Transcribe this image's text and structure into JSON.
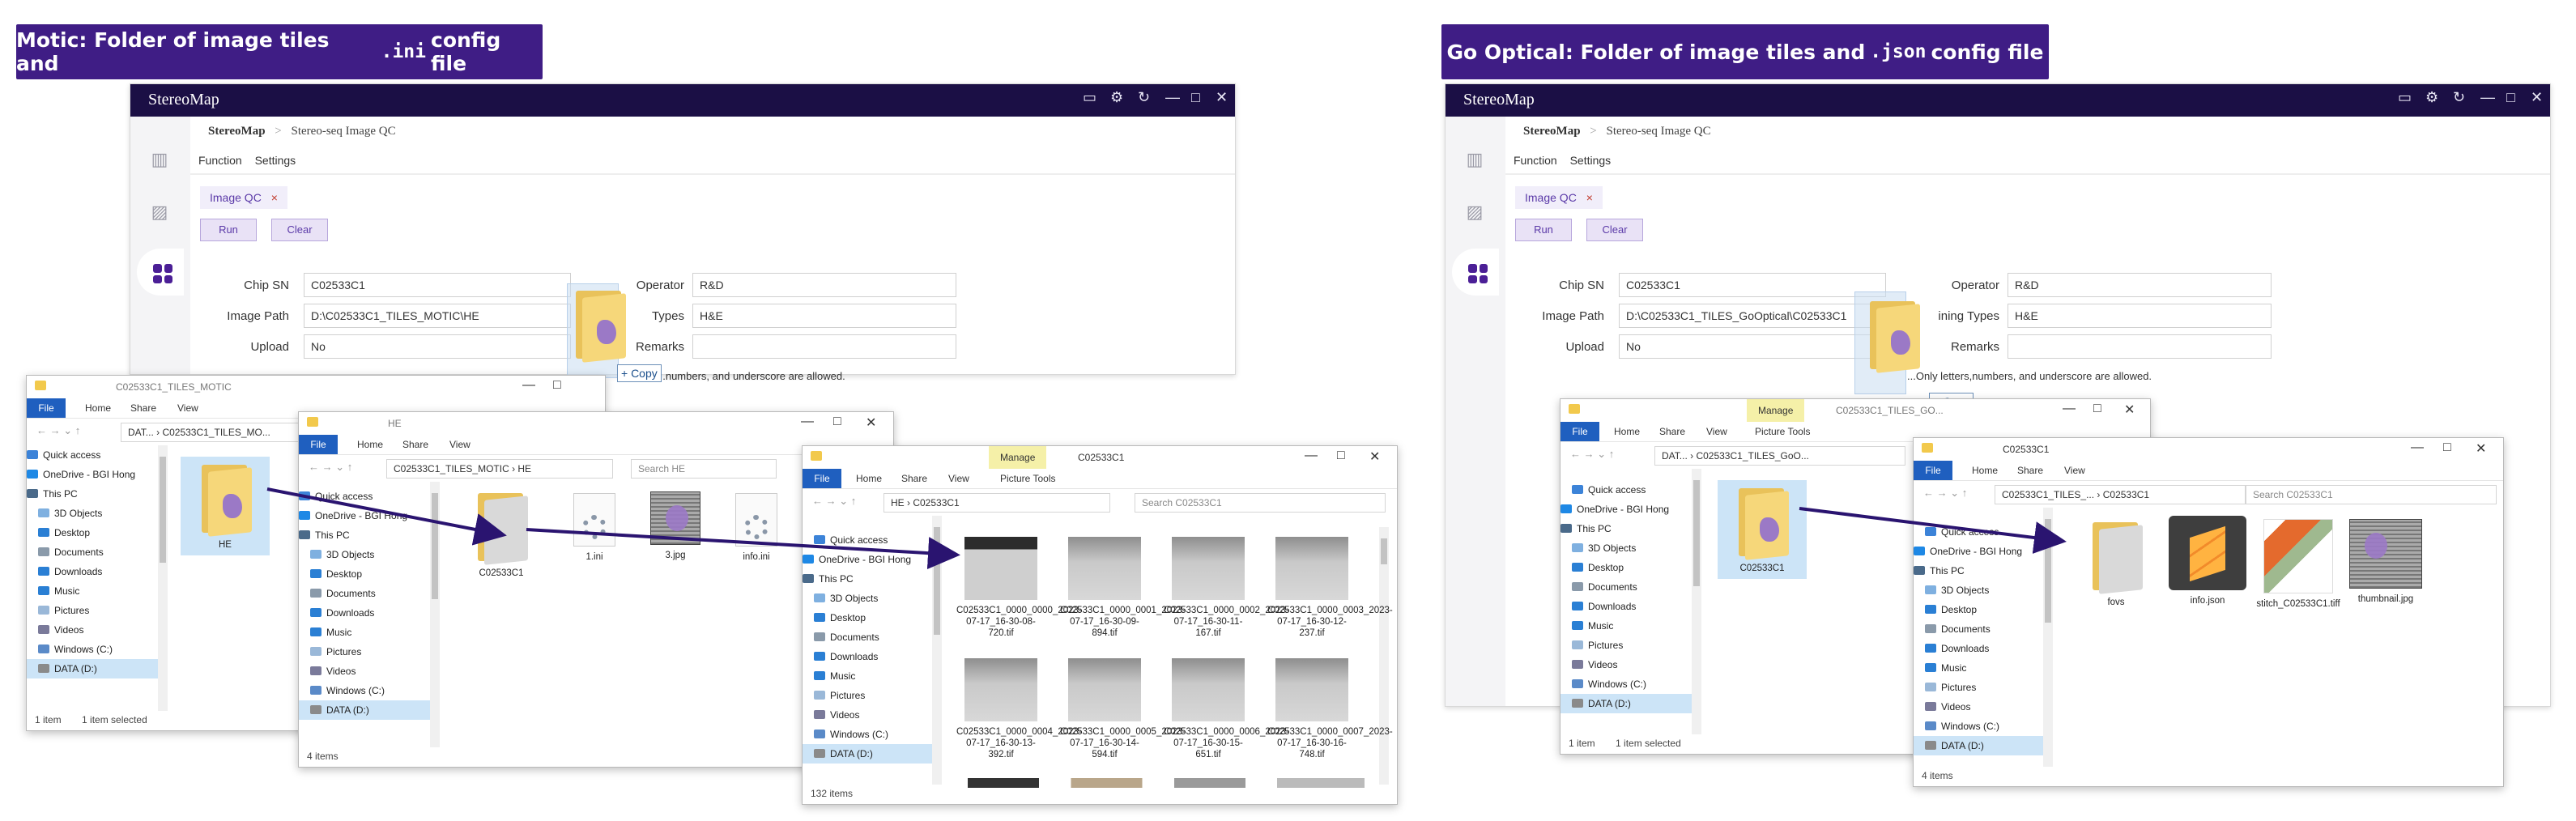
{
  "left": {
    "banner": {
      "prefix": "Motic: Folder of image tiles and",
      "code": ".ini",
      "suffix": "config file"
    },
    "app": {
      "title": "StereoMap",
      "crumb_root": "StereoMap",
      "crumb_sep": ">",
      "crumb_page": "Stereo-seq Image QC",
      "menu": [
        "Function",
        "Settings"
      ],
      "tab": "Image QC",
      "tab_close": "×",
      "run": "Run",
      "clear": "Clear",
      "labels": {
        "chip_sn": "Chip SN",
        "image_path": "Image Path",
        "upload": "Upload",
        "operator": "Operator",
        "types": "Types",
        "remarks": "Remarks"
      },
      "values": {
        "chip_sn": "C02533C1",
        "image_path": "D:\\C02533C1_TILES_MOTIC\\HE",
        "upload": "No",
        "operator": "R&D",
        "types": "H&E"
      },
      "note": "...numbers, and underscore are allowed.",
      "copy_tip": "+ Copy"
    },
    "win1": {
      "title": "C02533C1_TILES_MOTIC",
      "tabs": [
        "File",
        "Home",
        "Share",
        "View"
      ],
      "address": "DAT... › C02533C1_TILES_MO...",
      "nav": [
        "Quick access",
        "OneDrive - BGI Hong",
        "This PC",
        "3D Objects",
        "Desktop",
        "Documents",
        "Downloads",
        "Music",
        "Pictures",
        "Videos",
        "Windows (C:)",
        "DATA (D:)"
      ],
      "items": [
        {
          "name": "HE"
        }
      ],
      "status": [
        "1 item",
        "1 item selected"
      ]
    },
    "win2": {
      "title": "HE",
      "tabs": [
        "File",
        "Home",
        "Share",
        "View"
      ],
      "address": "C02533C1_TILES_MOTIC › HE",
      "search": "Search HE",
      "nav": [
        "Quick access",
        "OneDrive - BGI Hong",
        "This PC",
        "3D Objects",
        "Desktop",
        "Documents",
        "Downloads",
        "Music",
        "Pictures",
        "Videos",
        "Windows (C:)",
        "DATA (D:)"
      ],
      "items": [
        "C02533C1",
        "1.ini",
        "3.jpg",
        "info.ini"
      ],
      "status": "4 items"
    },
    "win3": {
      "title": "C02533C1",
      "manage": "Manage",
      "tabs": [
        "File",
        "Home",
        "Share",
        "View",
        "Picture Tools"
      ],
      "address": "HE › C02533C1",
      "search": "Search C02533C1",
      "nav": [
        "Quick access",
        "OneDrive - BGI Hong",
        "This PC",
        "3D Objects",
        "Desktop",
        "Documents",
        "Downloads",
        "Music",
        "Pictures",
        "Videos",
        "Windows (C:)",
        "DATA (D:)"
      ],
      "items": [
        "C02533C1_0000_0000_2023-07-17_16-30-08-720.tif",
        "C02533C1_0000_0001_2023-07-17_16-30-09-894.tif",
        "C02533C1_0000_0002_2023-07-17_16-30-11-167.tif",
        "C02533C1_0000_0003_2023-07-17_16-30-12-237.tif",
        "C02533C1_0000_0004_2023-07-17_16-30-13-392.tif",
        "C02533C1_0000_0005_2023-07-17_16-30-14-594.tif",
        "C02533C1_0000_0006_2023-07-17_16-30-15-651.tif",
        "C02533C1_0000_0007_2023-07-17_16-30-16-748.tif"
      ],
      "status": "132 items"
    }
  },
  "right": {
    "banner": {
      "prefix": "Go Optical: Folder of image tiles and",
      "code": ".json",
      "suffix": "config file"
    },
    "app": {
      "title": "StereoMap",
      "crumb_root": "StereoMap",
      "crumb_sep": ">",
      "crumb_page": "Stereo-seq Image QC",
      "menu": [
        "Function",
        "Settings"
      ],
      "tab": "Image QC",
      "tab_close": "×",
      "run": "Run",
      "clear": "Clear",
      "labels": {
        "chip_sn": "Chip SN",
        "image_path": "Image Path",
        "upload": "Upload",
        "operator": "Operator",
        "types": "ining Types",
        "remarks": "Remarks"
      },
      "values": {
        "chip_sn": "C02533C1",
        "image_path": "D:\\C02533C1_TILES_GoOptical\\C02533C1",
        "upload": "No",
        "operator": "R&D",
        "types": "H&E"
      },
      "note": "...Only letters,numbers, and underscore are allowed.",
      "copy_tip": "+ Copy"
    },
    "win1": {
      "title": "C02533C1_TILES_GO...",
      "manage": "Manage",
      "tabs": [
        "File",
        "Home",
        "Share",
        "View",
        "Picture Tools"
      ],
      "address": "DAT... › C02533C1_TILES_GoO...",
      "nav": [
        "Quick access",
        "OneDrive - BGI Hong",
        "This PC",
        "3D Objects",
        "Desktop",
        "Documents",
        "Downloads",
        "Music",
        "Pictures",
        "Videos",
        "Windows (C:)",
        "DATA (D:)"
      ],
      "items": [
        {
          "name": "C02533C1"
        }
      ],
      "status": [
        "1 item",
        "1 item selected"
      ]
    },
    "win2": {
      "title": "C02533C1",
      "tabs": [
        "File",
        "Home",
        "Share",
        "View"
      ],
      "address": "C02533C1_TILES_... › C02533C1",
      "search": "Search C02533C1",
      "nav": [
        "Quick access",
        "OneDrive - BGI Hong",
        "This PC",
        "3D Objects",
        "Desktop",
        "Documents",
        "Downloads",
        "Music",
        "Pictures",
        "Videos",
        "Windows (C:)",
        "DATA (D:)"
      ],
      "items": [
        "fovs",
        "info.json",
        "stitch_C02533C1.tiff",
        "thumbnail.jpg"
      ],
      "status": "4 items"
    }
  },
  "colors": {
    "banner": "#3f1d85",
    "titlebar": "#1b0f45",
    "accent": "#5b3aa8",
    "arrow": "#2a1470",
    "explorer_file_tab": "#1f5fbf"
  }
}
